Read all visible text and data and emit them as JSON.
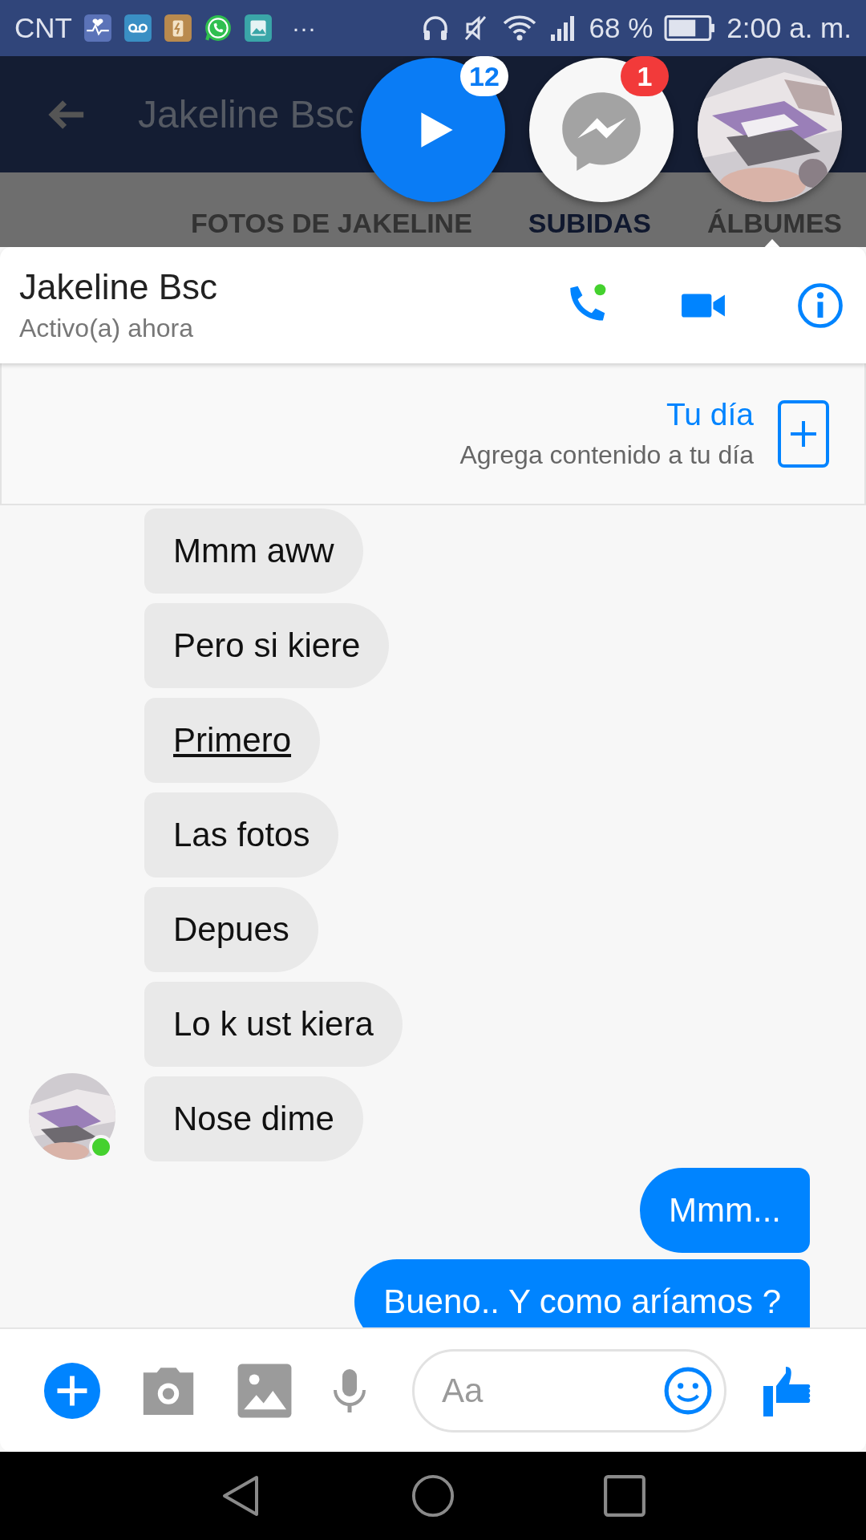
{
  "status_bar": {
    "carrier": "CNT",
    "more": "···",
    "battery_percent": "68 %",
    "time": "2:00 a. m."
  },
  "background_page": {
    "title": "Jakeline Bsc",
    "tabs": [
      {
        "label": "FOTOS DE JAKELINE",
        "selected": false
      },
      {
        "label": "SUBIDAS",
        "selected": true
      },
      {
        "label": "ÁLBUMES",
        "selected": false
      }
    ]
  },
  "chat_heads": [
    {
      "kind": "video",
      "badge": "12"
    },
    {
      "kind": "messenger",
      "badge": "1"
    },
    {
      "kind": "avatar"
    }
  ],
  "chat": {
    "name": "Jakeline Bsc",
    "status": "Activo(a) ahora",
    "online": true
  },
  "story": {
    "title": "Tu día",
    "subtitle": "Agrega contenido a tu día"
  },
  "messages": [
    {
      "text": "Mmm aww",
      "outgoing": false,
      "underlined": false
    },
    {
      "text": "Pero  si kiere",
      "outgoing": false,
      "underlined": false
    },
    {
      "text": "Primero",
      "outgoing": false,
      "underlined": true
    },
    {
      "text": "Las fotos",
      "outgoing": false,
      "underlined": false
    },
    {
      "text": "Depues",
      "outgoing": false,
      "underlined": false
    },
    {
      "text": "Lo k ust kiera",
      "outgoing": false,
      "underlined": false
    },
    {
      "text": "Nose dime",
      "outgoing": false,
      "underlined": false
    },
    {
      "text": "Mmm...",
      "outgoing": true,
      "underlined": false
    },
    {
      "text": "Bueno.. Y como aríamos ?",
      "outgoing": true,
      "underlined": false
    }
  ],
  "composer": {
    "placeholder": "Aa"
  }
}
